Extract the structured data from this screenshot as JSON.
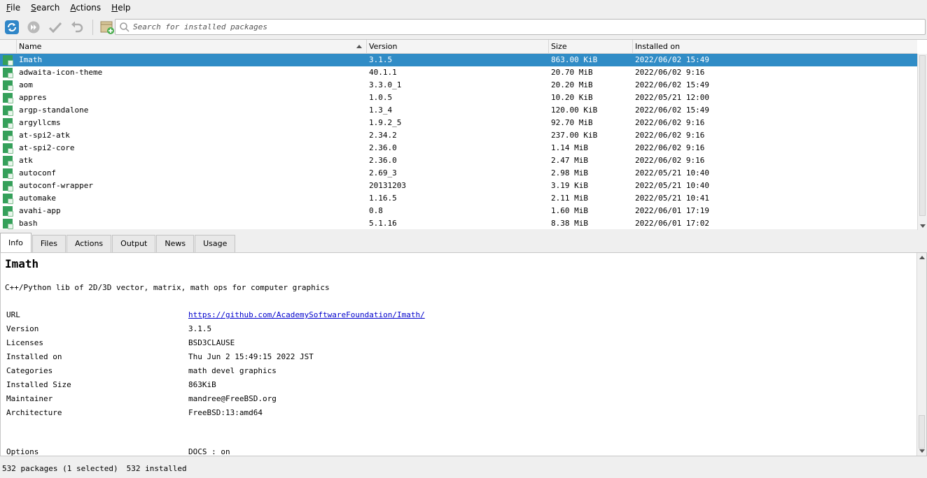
{
  "menubar": {
    "items": [
      {
        "first": "F",
        "rest": "ile"
      },
      {
        "first": "S",
        "rest": "earch"
      },
      {
        "first": "A",
        "rest": "ctions"
      },
      {
        "first": "H",
        "rest": "elp"
      }
    ]
  },
  "toolbar": {
    "icons": [
      "refresh-icon",
      "upgrade-all-icon",
      "apply-icon",
      "undo-icon",
      "add-package-icon"
    ],
    "search_placeholder": "Search for installed packages"
  },
  "table": {
    "columns": [
      "Name",
      "Version",
      "Size",
      "Installed on"
    ],
    "sort_column": "Name",
    "rows": [
      {
        "name": "Imath",
        "version": "3.1.5",
        "size": "863.00 KiB",
        "installed": "2022/06/02 15:49",
        "selected": true
      },
      {
        "name": "adwaita-icon-theme",
        "version": "40.1.1",
        "size": "20.70 MiB",
        "installed": "2022/06/02 9:16"
      },
      {
        "name": "aom",
        "version": "3.3.0_1",
        "size": "20.20 MiB",
        "installed": "2022/06/02 15:49"
      },
      {
        "name": "appres",
        "version": "1.0.5",
        "size": "10.20 KiB",
        "installed": "2022/05/21 12:00"
      },
      {
        "name": "argp-standalone",
        "version": "1.3_4",
        "size": "120.00 KiB",
        "installed": "2022/06/02 15:49"
      },
      {
        "name": "argyllcms",
        "version": "1.9.2_5",
        "size": "92.70 MiB",
        "installed": "2022/06/02 9:16"
      },
      {
        "name": "at-spi2-atk",
        "version": "2.34.2",
        "size": "237.00 KiB",
        "installed": "2022/06/02 9:16"
      },
      {
        "name": "at-spi2-core",
        "version": "2.36.0",
        "size": "1.14 MiB",
        "installed": "2022/06/02 9:16"
      },
      {
        "name": "atk",
        "version": "2.36.0",
        "size": "2.47 MiB",
        "installed": "2022/06/02 9:16"
      },
      {
        "name": "autoconf",
        "version": "2.69_3",
        "size": "2.98 MiB",
        "installed": "2022/05/21 10:40"
      },
      {
        "name": "autoconf-wrapper",
        "version": "20131203",
        "size": "3.19 KiB",
        "installed": "2022/05/21 10:40"
      },
      {
        "name": "automake",
        "version": "1.16.5",
        "size": "2.11 MiB",
        "installed": "2022/05/21 10:41"
      },
      {
        "name": "avahi-app",
        "version": "0.8",
        "size": "1.60 MiB",
        "installed": "2022/06/01 17:19"
      },
      {
        "name": "bash",
        "version": "5.1.16",
        "size": "8.38 MiB",
        "installed": "2022/06/01 17:02"
      }
    ]
  },
  "tabs": [
    {
      "label": "Info",
      "active": true
    },
    {
      "label": "Files"
    },
    {
      "label": "Actions"
    },
    {
      "label": "Output"
    },
    {
      "label": "News"
    },
    {
      "label": "Usage"
    }
  ],
  "info": {
    "title": "Imath",
    "description": "C++/Python lib of 2D/3D vector, matrix, math ops for computer graphics",
    "fields": [
      {
        "label": "URL",
        "value": "https://github.com/AcademySoftwareFoundation/Imath/",
        "link": true
      },
      {
        "label": "Version",
        "value": "3.1.5"
      },
      {
        "label": "Licenses",
        "value": "BSD3CLAUSE"
      },
      {
        "label": "Installed on",
        "value": "Thu Jun 2 15:49:15 2022 JST"
      },
      {
        "label": "Categories",
        "value": "math devel graphics"
      },
      {
        "label": "Installed Size",
        "value": "863KiB"
      },
      {
        "label": "Maintainer",
        "value": "mandree@FreeBSD.org"
      },
      {
        "label": "Architecture",
        "value": "FreeBSD:13:amd64"
      },
      {
        "label": "Options",
        "value": "DOCS : on"
      }
    ]
  },
  "status": {
    "packages": "532 packages (1 selected)",
    "installed": "532 installed"
  },
  "colors": {
    "selection": "#308cc6",
    "package_icon": "#35a05a",
    "refresh_icon": "#2f86c8",
    "link": "#0000cc"
  }
}
